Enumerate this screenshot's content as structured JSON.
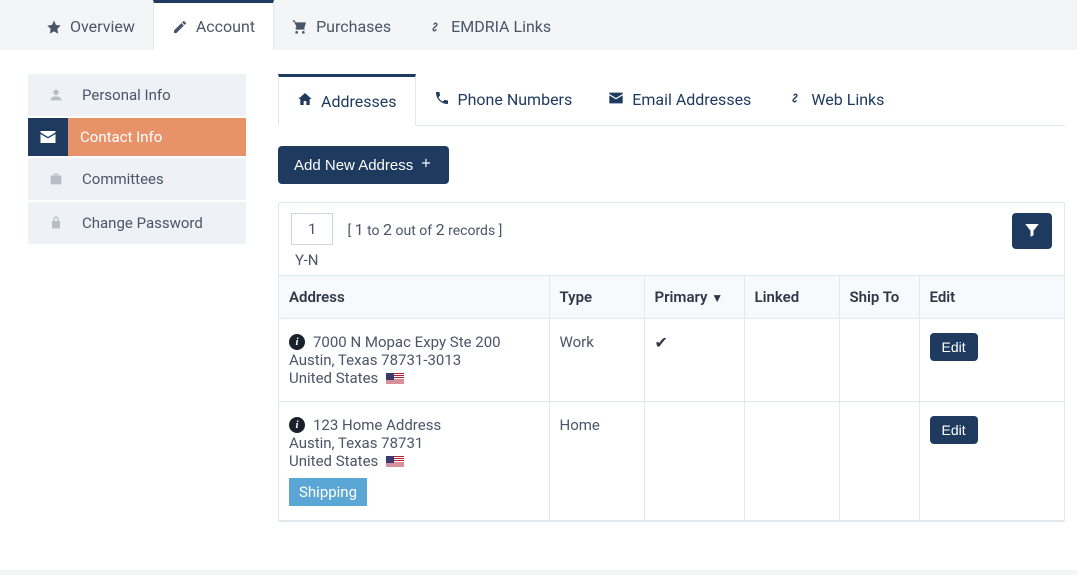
{
  "topTabs": [
    {
      "label": "Overview",
      "icon": "star"
    },
    {
      "label": "Account",
      "icon": "pencil",
      "active": true
    },
    {
      "label": "Purchases",
      "icon": "cart"
    },
    {
      "label": "EMDRIA Links",
      "icon": "link"
    }
  ],
  "sidebar": [
    {
      "label": "Personal Info",
      "icon": "user"
    },
    {
      "label": "Contact Info",
      "icon": "envelope",
      "active": true
    },
    {
      "label": "Committees",
      "icon": "briefcase"
    },
    {
      "label": "Change Password",
      "icon": "lock"
    }
  ],
  "subTabs": [
    {
      "label": "Addresses",
      "icon": "home",
      "active": true
    },
    {
      "label": "Phone Numbers",
      "icon": "phone"
    },
    {
      "label": "Email Addresses",
      "icon": "mail"
    },
    {
      "label": "Web Links",
      "icon": "link"
    }
  ],
  "addButtonLabel": "Add New Address",
  "pager": {
    "page": "1",
    "from": "1",
    "to": "2",
    "total": "2",
    "text_to": "to",
    "text_outof": "out of",
    "text_records": "records",
    "sortLabel": "Y-N"
  },
  "columns": {
    "address": "Address",
    "type": "Type",
    "primary": "Primary",
    "linked": "Linked",
    "shipTo": "Ship To",
    "edit": "Edit"
  },
  "rows": [
    {
      "line1": "7000 N Mopac Expy Ste 200",
      "line2": "Austin, Texas 78731-3013",
      "line3": "United States",
      "type": "Work",
      "primary": true,
      "shippingBadge": false,
      "editLabel": "Edit"
    },
    {
      "line1": "123 Home Address",
      "line2": "Austin, Texas 78731",
      "line3": "United States",
      "type": "Home",
      "primary": false,
      "shippingBadge": true,
      "shippingLabel": "Shipping",
      "editLabel": "Edit"
    }
  ]
}
